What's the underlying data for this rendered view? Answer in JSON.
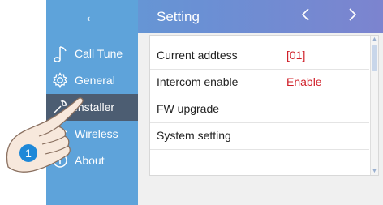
{
  "topbar": {
    "back_icon": "left-arrow-icon",
    "back_glyph": "←",
    "title": "Setting",
    "prev_glyph": "〈",
    "next_glyph": "〉"
  },
  "sidebar": {
    "items": [
      {
        "label": "Call Tune",
        "icon": "music-note-icon",
        "active": false
      },
      {
        "label": "General",
        "icon": "gear-icon",
        "active": false
      },
      {
        "label": "Installer",
        "icon": "wrench-icon",
        "active": true
      },
      {
        "label": "Wireless",
        "icon": "wifi-icon",
        "active": false
      },
      {
        "label": "About",
        "icon": "info-icon",
        "active": false
      }
    ]
  },
  "content": {
    "rows": [
      {
        "label": "Current addtess",
        "value": "[01]"
      },
      {
        "label": "Intercom enable",
        "value": "Enable"
      },
      {
        "label": "FW upgrade",
        "value": ""
      },
      {
        "label": "System setting",
        "value": ""
      }
    ]
  },
  "overlay": {
    "step_number": "1"
  },
  "colors": {
    "sidebar_bg": "#5ea3da",
    "active_item_bg": "#4c5d72",
    "value_red": "#d0202a",
    "badge_blue": "#1e88d8"
  }
}
